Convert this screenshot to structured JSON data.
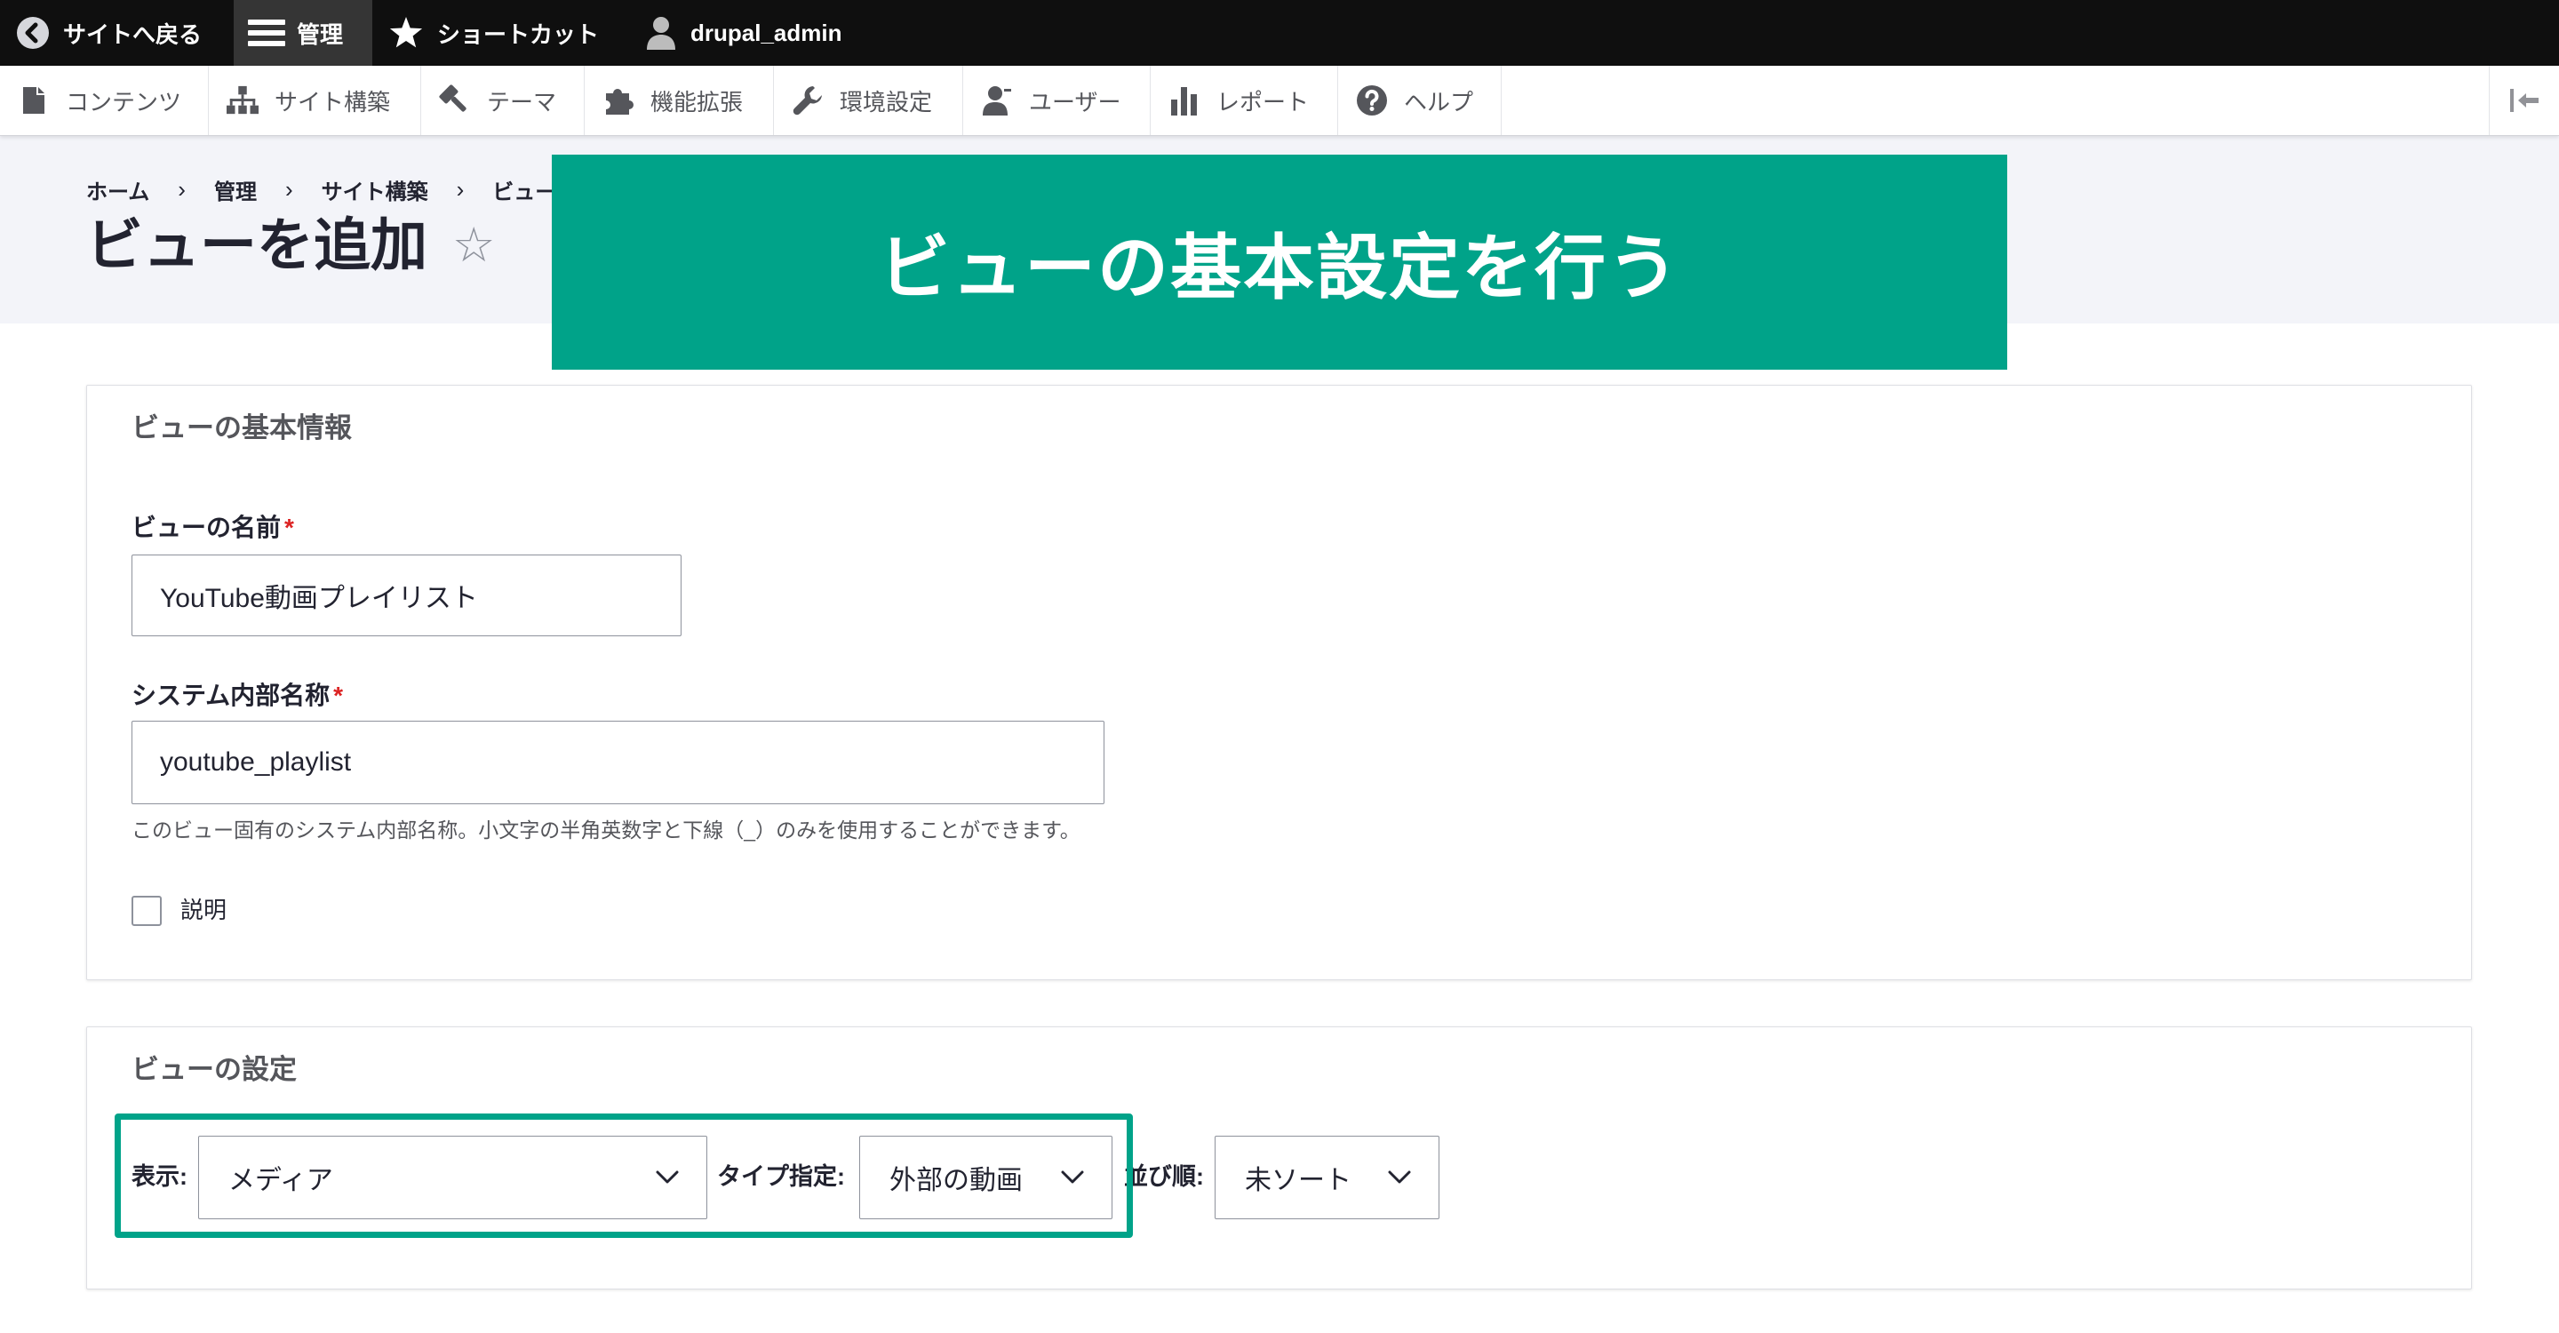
{
  "toolbar": {
    "back": {
      "label": "サイトへ戻る",
      "icon": "back-arrow-icon"
    },
    "manage": {
      "label": "管理",
      "icon": "hamburger-icon"
    },
    "shortcuts": {
      "label": "ショートカット",
      "icon": "star-icon"
    },
    "user": {
      "label": "drupal_admin",
      "icon": "user-icon"
    }
  },
  "admin_menu": {
    "items": [
      {
        "label": "コンテンツ",
        "icon": "file-icon"
      },
      {
        "label": "サイト構築",
        "icon": "sitemap-icon"
      },
      {
        "label": "テーマ",
        "icon": "paintbrush-icon"
      },
      {
        "label": "機能拡張",
        "icon": "puzzle-icon"
      },
      {
        "label": "環境設定",
        "icon": "wrench-icon"
      },
      {
        "label": "ユーザー",
        "icon": "person-icon"
      },
      {
        "label": "レポート",
        "icon": "bar-chart-icon"
      },
      {
        "label": "ヘルプ",
        "icon": "help-icon"
      }
    ],
    "collapse_icon": "collapse-left-icon"
  },
  "breadcrumb": {
    "items": [
      "ホーム",
      "管理",
      "サイト構築",
      "ビュー"
    ],
    "separator": "›"
  },
  "page": {
    "title": "ビューを追加",
    "favorite_glyph": "☆",
    "favorite_icon": "star-outline-icon"
  },
  "banner": {
    "text": "ビューの基本設定を行う"
  },
  "basic_info": {
    "legend": "ビューの基本情報",
    "name": {
      "label": "ビューの名前",
      "required_mark": "*",
      "value": "YouTube動画プレイリスト"
    },
    "machine_name": {
      "label": "システム内部名称",
      "required_mark": "*",
      "value": "youtube_playlist",
      "description": "このビュー固有のシステム内部名称。小文字の半角英数字と下線（_）のみを使用することができます。"
    },
    "description_checkbox": {
      "label": "説明",
      "checked": false
    }
  },
  "view_settings": {
    "legend": "ビューの設定",
    "show": {
      "label": "表示:",
      "selected": "メディア"
    },
    "type": {
      "label": "タイプ指定:",
      "selected": "外部の動画"
    },
    "sort": {
      "label": "並び順:",
      "selected": "未ソート"
    },
    "dropdown_icon": "chevron-down-icon"
  },
  "colors": {
    "accent": "#00a389",
    "toolbar_bg": "#0f0f0f",
    "header_bg": "#f3f4f9",
    "required": "#dc2323",
    "text_muted": "#55565b"
  }
}
